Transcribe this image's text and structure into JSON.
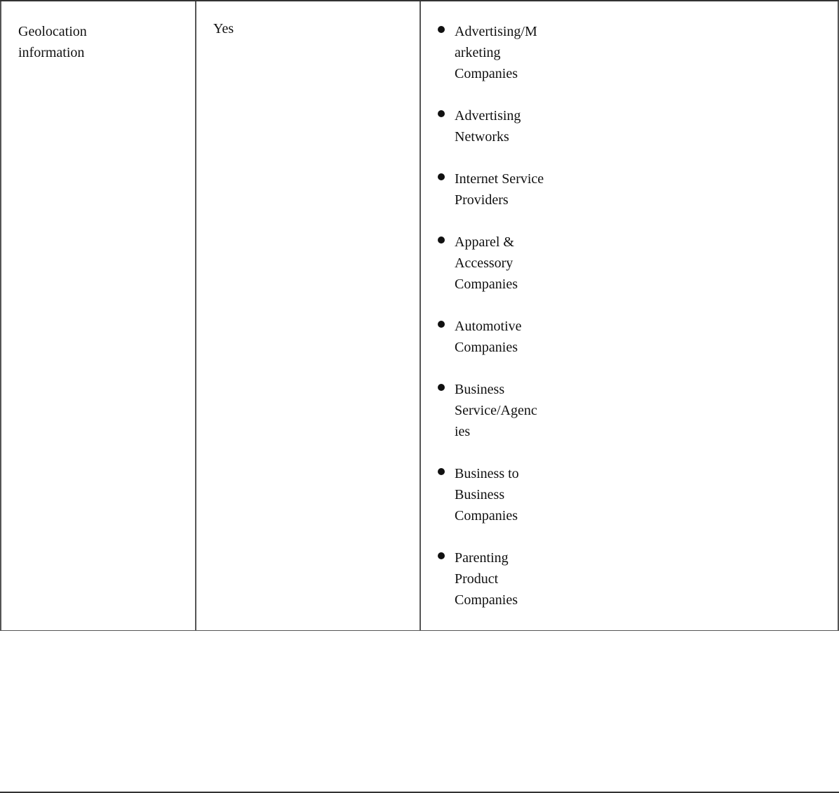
{
  "table": {
    "row": {
      "category": {
        "line1": "Geolocation",
        "line2": "information"
      },
      "disclosed": "Yes",
      "companies": [
        "Advertising/Marketing Companies",
        "Advertising Networks",
        "Internet Service Providers",
        "Apparel & Accessory Companies",
        "Automotive Companies",
        "Business Service/Agencies",
        "Business to Business Companies",
        "Parenting Product Companies"
      ]
    }
  }
}
